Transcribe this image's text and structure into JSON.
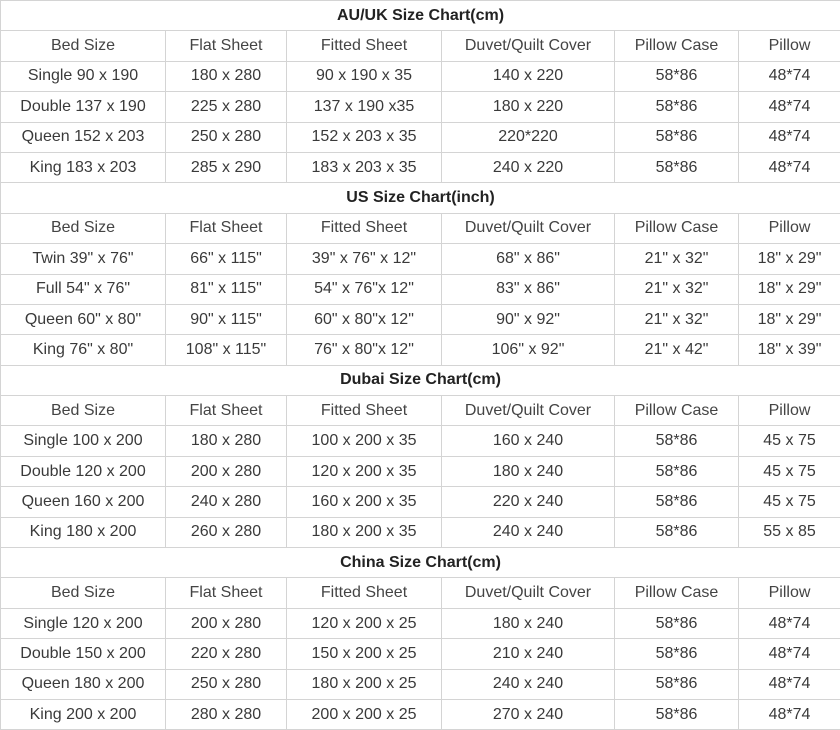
{
  "headers": [
    "Bed Size",
    "Flat Sheet",
    "Fitted Sheet",
    "Duvet/Quilt Cover",
    "Pillow Case",
    "Pillow"
  ],
  "charts": [
    {
      "title": "AU/UK Size Chart(cm)",
      "rows": [
        [
          "Single 90 x 190",
          "180 x 280",
          "90 x 190 x 35",
          "140 x 220",
          "58*86",
          "48*74"
        ],
        [
          "Double 137 x 190",
          "225 x 280",
          "137 x 190 x35",
          "180 x 220",
          "58*86",
          "48*74"
        ],
        [
          "Queen 152 x 203",
          "250 x 280",
          "152 x 203 x 35",
          "220*220",
          "58*86",
          "48*74"
        ],
        [
          "King 183 x 203",
          "285 x 290",
          "183 x 203 x 35",
          "240 x 220",
          "58*86",
          "48*74"
        ]
      ]
    },
    {
      "title": "US Size Chart(inch)",
      "rows": [
        [
          "Twin 39\" x 76\"",
          "66\" x 115\"",
          "39\" x 76\" x 12\"",
          "68\" x 86\"",
          "21\" x 32\"",
          "18\" x 29\""
        ],
        [
          "Full 54\" x 76\"",
          "81\" x 115\"",
          "54\" x 76\"x 12\"",
          "83\" x 86\"",
          "21\" x 32\"",
          "18\" x 29\""
        ],
        [
          "Queen 60\" x 80\"",
          "90\" x 115\"",
          "60\" x 80\"x 12\"",
          "90\" x 92\"",
          "21\" x 32\"",
          "18\" x 29\""
        ],
        [
          "King 76\" x 80\"",
          "108\" x 115\"",
          "76\" x 80\"x 12\"",
          "106\" x 92\"",
          "21\" x 42\"",
          "18\" x 39\""
        ]
      ]
    },
    {
      "title": "Dubai Size Chart(cm)",
      "rows": [
        [
          "Single 100 x 200",
          "180 x 280",
          "100 x 200 x 35",
          "160 x 240",
          "58*86",
          "45 x 75"
        ],
        [
          "Double 120 x 200",
          "200 x 280",
          "120 x 200 x 35",
          "180 x 240",
          "58*86",
          "45 x 75"
        ],
        [
          "Queen 160 x 200",
          "240 x 280",
          "160 x 200 x 35",
          "220 x 240",
          "58*86",
          "45 x 75"
        ],
        [
          "King 180 x 200",
          "260 x 280",
          "180 x 200 x 35",
          "240 x 240",
          "58*86",
          "55 x 85"
        ]
      ]
    },
    {
      "title": "China Size Chart(cm)",
      "rows": [
        [
          "Single 120 x 200",
          "200 x 280",
          "120 x 200 x 25",
          "180 x 240",
          "58*86",
          "48*74"
        ],
        [
          "Double 150 x 200",
          "220 x 280",
          "150 x 200 x 25",
          "210 x 240",
          "58*86",
          "48*74"
        ],
        [
          "Queen 180 x 200",
          "250 x 280",
          "180 x 200 x 25",
          "240 x 240",
          "58*86",
          "48*74"
        ],
        [
          "King 200 x 200",
          "280 x 280",
          "200 x 200 x 25",
          "270 x 240",
          "58*86",
          "48*74"
        ]
      ]
    }
  ]
}
